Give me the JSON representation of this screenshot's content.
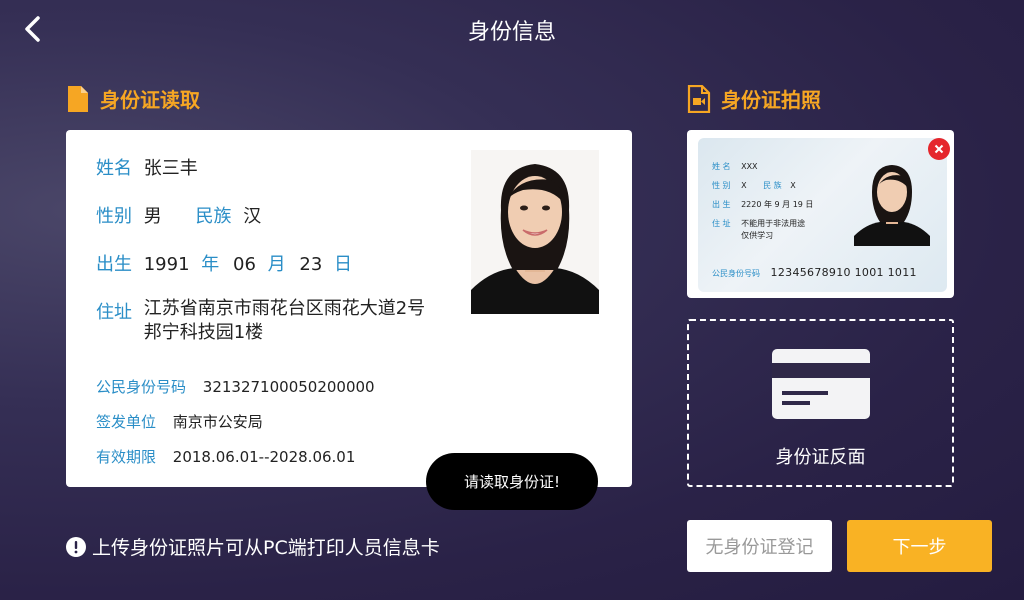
{
  "header": {
    "title": "身份信息"
  },
  "read_section": {
    "heading": "身份证读取"
  },
  "photo_section": {
    "heading": "身份证拍照"
  },
  "id_info": {
    "name_label": "姓名",
    "name": "张三丰",
    "gender_label": "性别",
    "gender": "男",
    "ethnic_label": "民族",
    "ethnic": "汉",
    "birth_label": "出生",
    "birth_year": "1991",
    "year_unit": "年",
    "birth_month": "06",
    "month_unit": "月",
    "birth_day": "23",
    "day_unit": "日",
    "address_label": "住址",
    "address_line1": "江苏省南京市雨花台区雨花大道2号",
    "address_line2": "邦宁科技园1楼",
    "id_number_label": "公民身份号码",
    "id_number": "321327100050200000",
    "authority_label": "签发单位",
    "authority": "南京市公安局",
    "validity_label": "有效期限",
    "validity": "2018.06.01--2028.06.01"
  },
  "id_thumbnail": {
    "name_label": "姓 名",
    "name": "XXX",
    "gender_label": "性 别",
    "gender": "X",
    "ethnic_label": "民 族",
    "ethnic": "X",
    "birth_label": "出 生",
    "birth": "2220 年 9 月 19 日",
    "address_label": "住 址",
    "address_line1": "不能用于非法用途",
    "address_line2": "仅供学习",
    "number_label": "公民身份号码",
    "number": "12345678910 1001 1011"
  },
  "back_slot": {
    "label": "身份证反面"
  },
  "toast": {
    "text": "请读取身份证!"
  },
  "footer": {
    "note": "上传身份证照片可从PC端打印人员信息卡",
    "no_id_button": "无身份证登记",
    "next_button": "下一步"
  },
  "colors": {
    "accent": "#f6a623",
    "label_blue": "#2a8ec7",
    "button_yellow": "#f9b224",
    "delete_red": "#e5262c"
  }
}
